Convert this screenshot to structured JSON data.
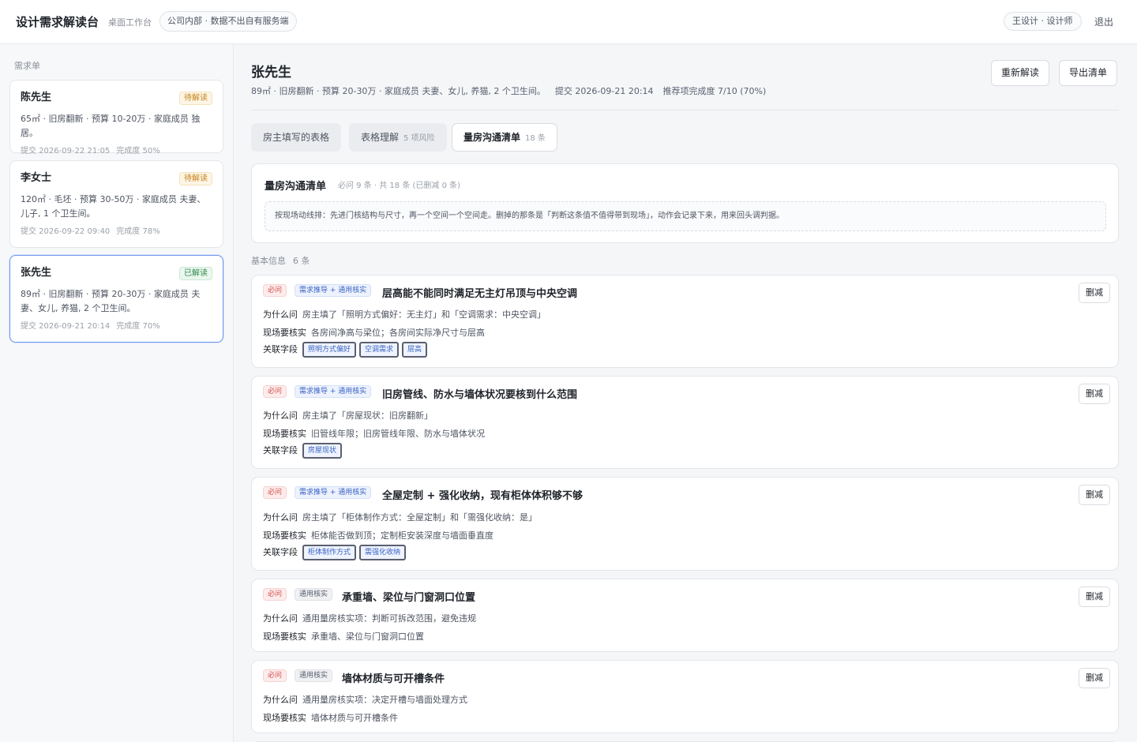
{
  "header": {
    "title": "设计需求解读台",
    "subtitle": "桌面工作台",
    "env_badge": "公司内部 · 数据不出自有服务端",
    "user": "王设计 · 设计师",
    "logout": "退出"
  },
  "sidebar": {
    "title": "需求单",
    "cards": [
      {
        "name": "陈先生",
        "status": "待解读",
        "desc": "65㎡ · 旧房翻新 · 预算 10-20万 · 家庭成员 独居。",
        "submitted": "提交 2026-09-22 21:05",
        "completion": "完成度 50%"
      },
      {
        "name": "李女士",
        "status": "待解读",
        "desc": "120㎡ · 毛坯 · 预算 30-50万 · 家庭成员 夫妻、儿子, 1 个卫生间。",
        "submitted": "提交 2026-09-22 09:40",
        "completion": "完成度 78%"
      },
      {
        "name": "张先生",
        "status": "已解读",
        "desc": "89㎡ · 旧房翻新 · 预算 20-30万 · 家庭成员 夫妻、女儿, 养猫, 2 个卫生间。",
        "submitted": "提交 2026-09-21 20:14",
        "completion": "完成度 70%"
      }
    ]
  },
  "main": {
    "customer_name": "张先生",
    "customer_info": "89㎡ · 旧房翻新 · 预算 20-30万 · 家庭成员 夫妻、女儿, 养猫, 2 个卫生间。",
    "submitted": "提交 2026-09-21 20:14",
    "recommend": "推荐项完成度 7/10 (70%)",
    "reanalyze_button": "重新解读",
    "export_button": "导出清单",
    "tabs": [
      {
        "label": "房主填写的表格",
        "count": ""
      },
      {
        "label": "表格理解",
        "count": "5 项风险"
      },
      {
        "label": "量房沟通清单",
        "count": "18 条"
      }
    ],
    "summary": {
      "title": "量房沟通清单",
      "meta": "必问 9 条 · 共 18 条 (已删减 0 条)",
      "note": "按现场动线排：先进门核结构与尺寸，再一个空间一个空间走。删掉的那条是「判断这条值不值得带到现场」，动作会记录下来，用来回头调判据。"
    },
    "section": {
      "title": "基本信息",
      "count": "6 条"
    },
    "labels": {
      "why": "为什么问",
      "verify": "现场要核实",
      "fields": "关联字段",
      "delete": "删减"
    },
    "items": [
      {
        "required": "必问",
        "source": "需求推导 + 通用核实",
        "source_type": "blue",
        "title": "层高能不能同时满足无主灯吊顶与中央空调",
        "why": "房主填了「照明方式偏好：无主灯」和「空调需求：中央空调」",
        "verify": "各房间净高与梁位；各房间实际净尺寸与层高",
        "fields": [
          "照明方式偏好",
          "空调需求",
          "层高"
        ]
      },
      {
        "required": "必问",
        "source": "需求推导 + 通用核实",
        "source_type": "blue",
        "title": "旧房管线、防水与墙体状况要核到什么范围",
        "why": "房主填了「房屋现状：旧房翻新」",
        "verify": "旧管线年限；旧房管线年限、防水与墙体状况",
        "fields": [
          "房屋现状"
        ]
      },
      {
        "required": "必问",
        "source": "需求推导 + 通用核实",
        "source_type": "blue",
        "title": "全屋定制 + 强化收纳，现有柜体体积够不够",
        "why": "房主填了「柜体制作方式：全屋定制」和「需强化收纳：是」",
        "verify": "柜体能否做到顶；定制柜安装深度与墙面垂直度",
        "fields": [
          "柜体制作方式",
          "需强化收纳"
        ]
      },
      {
        "required": "必问",
        "source": "通用核实",
        "source_type": "gray",
        "title": "承重墙、梁位与门窗洞口位置",
        "why": "通用量房核实项：判断可拆改范围，避免违规",
        "verify": "承重墙、梁位与门窗洞口位置",
        "fields": []
      },
      {
        "required": "必问",
        "source": "通用核实",
        "source_type": "gray",
        "title": "墙体材质与可开槽条件",
        "why": "通用量房核实项：决定开槽与墙面处理方式",
        "verify": "墙体材质与可开槽条件",
        "fields": []
      }
    ]
  }
}
